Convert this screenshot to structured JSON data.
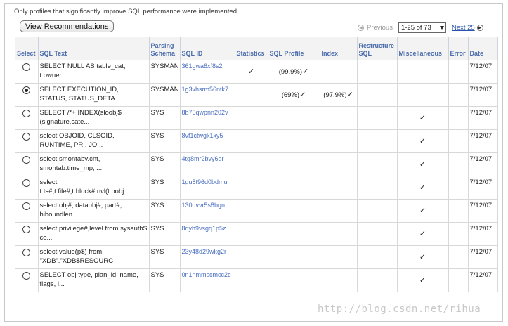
{
  "notice": "Only profiles that significantly improve SQL performance were implemented.",
  "toolbar": {
    "view_label": "View Recommendations"
  },
  "pager": {
    "prev_label": "Previous",
    "range": "1-25 of 73",
    "next_label": "Next 25"
  },
  "columns": [
    "Select",
    "SQL Text",
    "Parsing Schema",
    "SQL ID",
    "Statistics",
    "SQL Profile",
    "Index",
    "Restructure SQL",
    "Miscellaneous",
    "Error",
    "Date"
  ],
  "rows": [
    {
      "selected": false,
      "sql_text": "SELECT NULL AS table_cat, t.owner...",
      "schema": "SYSMAN",
      "sql_id": "361gwa6xf8s2",
      "statistics": true,
      "profile": "(99.9%)",
      "profile_check": true,
      "index": "",
      "index_check": false,
      "misc": false,
      "date": "7/12/07"
    },
    {
      "selected": true,
      "sql_text": "SELECT EXECUTION_ID, STATUS, STATUS_DETA",
      "schema": "SYSMAN",
      "sql_id": "1g3vhsrm56ntk7",
      "statistics": false,
      "profile": "(69%)",
      "profile_check": true,
      "index": "(97.9%)",
      "index_check": true,
      "misc": false,
      "date": "7/12/07"
    },
    {
      "selected": false,
      "sql_text": "SELECT /*+ INDEX(sloobj$ (signature,cate...",
      "schema": "SYS",
      "sql_id": "8b75qwpnn202v",
      "statistics": false,
      "profile": "",
      "profile_check": false,
      "index": "",
      "index_check": false,
      "misc": true,
      "date": "7/12/07"
    },
    {
      "selected": false,
      "sql_text": "select OBJOID, CLSOID, RUNTIME, PRI, JO...",
      "schema": "SYS",
      "sql_id": "8vf1ctwgk1xy5",
      "statistics": false,
      "profile": "",
      "profile_check": false,
      "index": "",
      "index_check": false,
      "misc": true,
      "date": "7/12/07"
    },
    {
      "selected": false,
      "sql_text": "select smontabv.cnt, smontab.time_mp, ...",
      "schema": "SYS",
      "sql_id": "4tg8mr2bvy6gr",
      "statistics": false,
      "profile": "",
      "profile_check": false,
      "index": "",
      "index_check": false,
      "misc": true,
      "date": "7/12/07"
    },
    {
      "selected": false,
      "sql_text": "select t.ts#,t.file#,t.block#,nvl(t.bobj...",
      "schema": "SYS",
      "sql_id": "1gu8t96d0bdmu",
      "statistics": false,
      "profile": "",
      "profile_check": false,
      "index": "",
      "index_check": false,
      "misc": true,
      "date": "7/12/07"
    },
    {
      "selected": false,
      "sql_text": "select obj#, dataobj#, part#, hiboundlen...",
      "schema": "SYS",
      "sql_id": "130dvvr5s8bgn",
      "statistics": false,
      "profile": "",
      "profile_check": false,
      "index": "",
      "index_check": false,
      "misc": true,
      "date": "7/12/07"
    },
    {
      "selected": false,
      "sql_text": "select privilege#,level from sysauth$ co...",
      "schema": "SYS",
      "sql_id": "8qyh9vsgq1p5z",
      "statistics": false,
      "profile": "",
      "profile_check": false,
      "index": "",
      "index_check": false,
      "misc": true,
      "date": "7/12/07"
    },
    {
      "selected": false,
      "sql_text": "select value(p$) from \"XDB\".\"XDB$RESOURC",
      "schema": "SYS",
      "sql_id": "23y48d29wkg2r",
      "statistics": false,
      "profile": "",
      "profile_check": false,
      "index": "",
      "index_check": false,
      "misc": true,
      "date": "7/12/07"
    },
    {
      "selected": false,
      "sql_text": "SELECT obj type, plan_id, name, flags, i...",
      "schema": "SYS",
      "sql_id": "0n1nmmscmcc2c",
      "statistics": false,
      "profile": "",
      "profile_check": false,
      "index": "",
      "index_check": false,
      "misc": true,
      "date": "7/12/07"
    }
  ],
  "check_glyph": "✓",
  "icons": {
    "prev": "circle-left-icon",
    "next": "circle-right-icon",
    "dropdown": "dropdown-arrow-icon"
  },
  "watermark": "http://blog.csdn.net/rihua"
}
